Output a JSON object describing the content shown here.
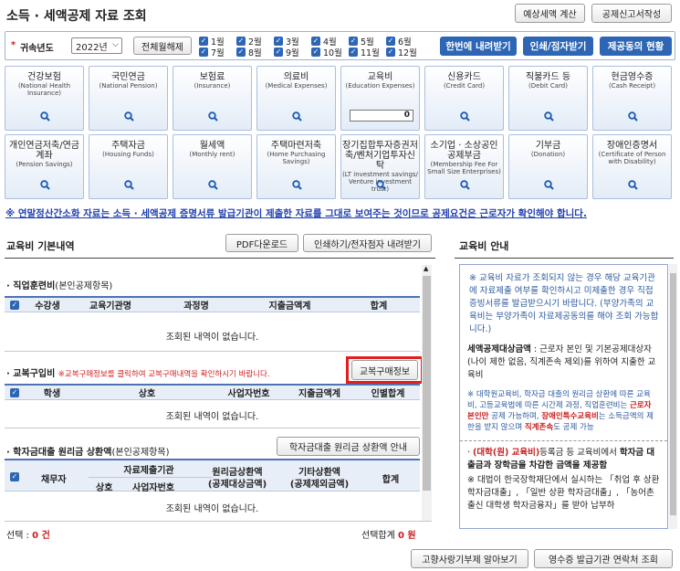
{
  "header": {
    "title": "소득 · 세액공제 자료 조회",
    "btn_tax_calc": "예상세액 계산",
    "btn_report": "공제신고서작성"
  },
  "filter": {
    "label": "귀속년도",
    "required_mark": "*",
    "year": "2022년",
    "select_all": "전체월해제",
    "months": [
      "1월",
      "2월",
      "3월",
      "4월",
      "5월",
      "6월",
      "7월",
      "8월",
      "9월",
      "10월",
      "11월",
      "12월"
    ],
    "btn_download": "한번에 내려받기",
    "btn_print": "인쇄/점자받기",
    "btn_consent": "제공동의 현황"
  },
  "tiles": [
    {
      "title": "건강보험",
      "sub": "(National Health Insurance)"
    },
    {
      "title": "국민연금",
      "sub": "(National Pension)"
    },
    {
      "title": "보험료",
      "sub": "(Insurance)"
    },
    {
      "title": "의료비",
      "sub": "(Medical Expenses)"
    },
    {
      "title": "교육비",
      "sub": "(Education Expenses)",
      "value": "0"
    },
    {
      "title": "신용카드",
      "sub": "(Credit Card)"
    },
    {
      "title": "직불카드 등",
      "sub": "(Debit Card)"
    },
    {
      "title": "현금영수증",
      "sub": "(Cash Receipt)"
    },
    {
      "title": "개인연금저축/연금계좌",
      "sub": "(Pension Savings)"
    },
    {
      "title": "주택자금",
      "sub": "(Housing Funds)"
    },
    {
      "title": "월세액",
      "sub": "(Monthly rent)"
    },
    {
      "title": "주택마련저축",
      "sub": "(Home Purchasing Savings)"
    },
    {
      "title": "장기집합투자증권저축/벤처기업투자신탁",
      "sub": "(LT investment savings/ Venture investment trust)"
    },
    {
      "title": "소기업 · 소상공인 공제부금",
      "sub": "(Membership Fee For Small Size Enterprises)"
    },
    {
      "title": "기부금",
      "sub": "(Donation)"
    },
    {
      "title": "장애인증명서",
      "sub": "(Certificate of Person with Disability)"
    }
  ],
  "notice": "※ 연말정산간소화 자료는 소득 · 세액공제 증명서류 발급기관이 제출한 자료를 그대로 보여주는 것이므로 공제요건은 근로자가 확인해야 합니다.",
  "left": {
    "title": "교육비 기본내역",
    "btn_pdf": "PDF다운로드",
    "btn_print": "인쇄하기/전자점자 내려받기",
    "s1": {
      "bullet": "·",
      "title": "직업훈련비",
      "note": "(본인공제항목)",
      "cols": [
        "수강생",
        "교육기관명",
        "과정명",
        "지출금액계",
        "합계"
      ],
      "empty": "조회된 내역이 없습니다."
    },
    "s2": {
      "bullet": "·",
      "title": "교복구입비",
      "note": "※교복구매정보를 클릭하여 교복구매내역을 확인하시기 바랍니다.",
      "btn": "교복구매정보",
      "cols": [
        "학생",
        "상호",
        "사업자번호",
        "지출금액계",
        "인별합계"
      ],
      "empty": "조회된 내역이 없습니다."
    },
    "s3": {
      "bullet": "·",
      "title": "학자금대출 원리금 상환액",
      "note": "(본인공제항목)",
      "btn": "학자금대출 원리금 상환액 안내",
      "cols": {
        "c1": "채무자",
        "c2": "자료제출기관",
        "c2a": "상호",
        "c2b": "사업자번호",
        "c3": "원리금상환액",
        "c3b": "(공제대상금액)",
        "c4": "기타상환액",
        "c4b": "(공제제외금액)",
        "c5": "합계"
      },
      "empty": "조회된 내역이 없습니다."
    },
    "footer": {
      "selected_label": "선택 : ",
      "selected_value": "0 건",
      "total_label": "선택합계 ",
      "total_value": "0 원"
    }
  },
  "right": {
    "title": "교육비 안내",
    "p1": "※ 교육비 자료가 조회되지 않는 경우 해당 교육기관에 자료제출 여부를 확인하시고 미제출한 경우 직접 증빙서류를 발급받으시기 바랍니다. (부양가족의 교육비는 부양가족이 자료제공동의를 해야 조회 가능합니다.)",
    "p2a": "세액공제대상금액",
    "p2b": " : 근로자 본인 및 기본공제대상자(나이 제한 없음, 직계존속 제외)를 위하여 지출한 교육비",
    "p3a": "※ 대학원교육비, 학자금 대출의 원리금 상환에 따른 교육비, 고등교육법에 따른 시간제 과정, 직업훈련비는 ",
    "p3b": "근로자 본인만",
    "p3c": " 공제 가능하며, ",
    "p3d": "장애인특수교육비",
    "p3e": "는 소득금액의 제한을 받지 않으며 ",
    "p3f": "직계존속",
    "p3g": "도 공제 가능",
    "p4a": "(대학(원) 교육비)",
    "p4b": "등록금 등 교육비에서 ",
    "p4c": "학자금 대출금과 장학금을 차감한 금액을 제공함",
    "p5": "※ 대법이 한국장학재단에서 실시하는 「취업 후 상환 학자금대출」, 「일반 상환 학자금대출」, 「농어촌출신 대학생 학자금융자」를 받아 납부하"
  },
  "bottom": {
    "btn_hometown": "고향사랑기부제 알아보기",
    "btn_receipt": "영수증 발급기관 연락처 조회"
  }
}
